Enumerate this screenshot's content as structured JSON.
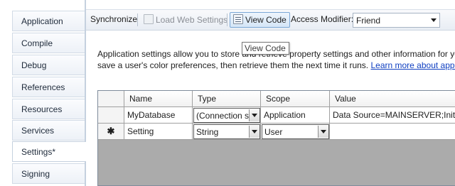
{
  "nav": {
    "items": [
      {
        "label": "Application"
      },
      {
        "label": "Compile"
      },
      {
        "label": "Debug"
      },
      {
        "label": "References"
      },
      {
        "label": "Resources"
      },
      {
        "label": "Services"
      },
      {
        "label": "Settings*"
      },
      {
        "label": "Signing"
      }
    ]
  },
  "toolbar": {
    "synchronize": "Synchronize",
    "load_web_settings": "Load Web Settings",
    "view_code": "View Code",
    "access_modifier_label": "Access Modifier:",
    "access_modifier_value": "Friend"
  },
  "tooltip": "View Code",
  "description": {
    "line1": "Application settings allow you to store and retrieve property settings and other information for your application dynamically. For example, the application can",
    "line2": "save a user's color preferences, then retrieve them the next time it runs.",
    "link": "Learn more about application settings..."
  },
  "grid": {
    "columns": [
      "Name",
      "Type",
      "Scope",
      "Value"
    ],
    "rows": [
      {
        "name": "MyDatabase",
        "type": "(Connection string)",
        "scope": "Application",
        "value": "Data Source=MAINSERVER;Initial Catalog"
      },
      {
        "marker": "✱",
        "name": "Setting",
        "type": "String",
        "scope": "User",
        "value": ""
      }
    ]
  },
  "colors": {
    "accent": "#7aa7d6",
    "link": "#0f3fc1",
    "grid_background": "#ababab"
  }
}
